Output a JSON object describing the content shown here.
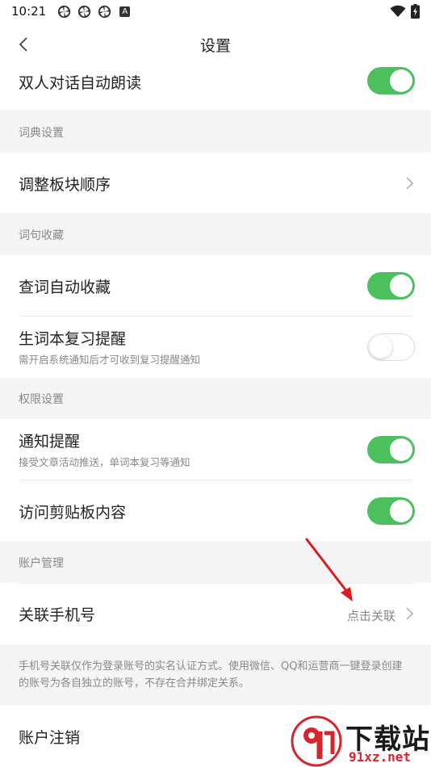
{
  "status_bar": {
    "time": "10:21",
    "app_badge": "A",
    "icons": [
      "pinwheel-icon",
      "pinwheel-icon",
      "pinwheel-icon",
      "app-a-icon",
      "wifi-icon",
      "battery-charging-icon"
    ]
  },
  "header": {
    "title": "设置",
    "back_icon": "chevron-left-icon"
  },
  "rows": {
    "dual_read": {
      "label": "双人对话自动朗读",
      "enabled": true
    },
    "reorder": {
      "label": "调整板块顺序"
    },
    "auto_fav": {
      "label": "查词自动收藏",
      "enabled": true
    },
    "review": {
      "label": "生词本复习提醒",
      "sub": "需开启系统通知后才可收到复习提醒通知",
      "enabled": false
    },
    "notify": {
      "label": "通知提醒",
      "sub": "接受文章活动推送，单词本复习等通知",
      "enabled": true
    },
    "clipboard": {
      "label": "访问剪贴板内容",
      "enabled": true
    },
    "phone": {
      "label": "关联手机号",
      "action": "点击关联"
    },
    "delete": {
      "label": "账户注销"
    }
  },
  "sections": {
    "dict": "词典设置",
    "fav": "词句收藏",
    "perm": "权限设置",
    "account": "账户管理"
  },
  "note": "手机号关联仅作为登录账号的实名认证方式。使用微信、QQ和运营商一键登录创建的账号为各自独立的账号，不存在合并绑定关系。",
  "colors": {
    "toggle_on": "#4cc05f",
    "annotation_arrow": "#e0191e",
    "background": "#f5f5f5"
  },
  "watermark": {
    "title": "下载站",
    "url": "91xz.net"
  }
}
